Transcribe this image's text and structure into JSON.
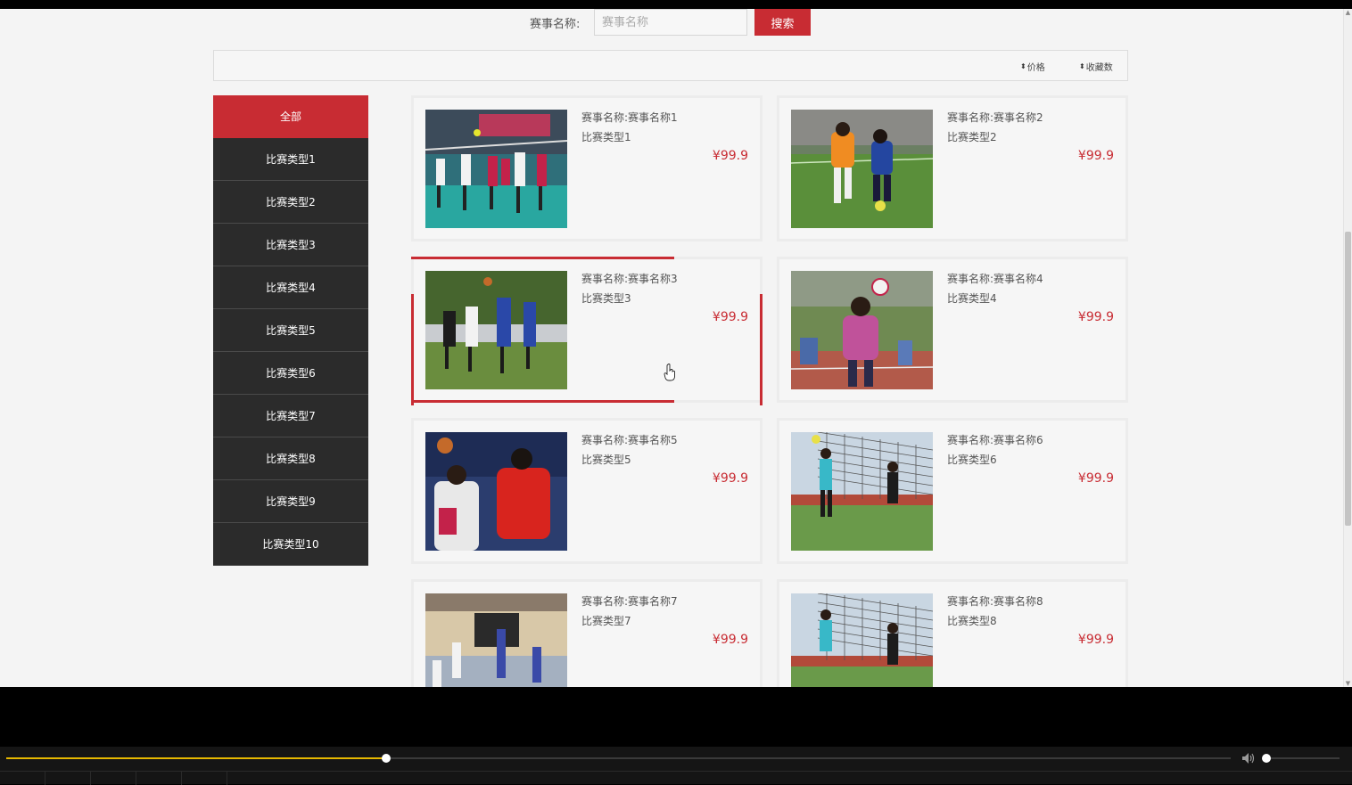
{
  "search": {
    "label": "赛事名称:",
    "placeholder": "赛事名称",
    "value": "",
    "button_label": "搜索"
  },
  "sort": {
    "price_label": "价格",
    "favorites_label": "收藏数",
    "icon": "sort-icon"
  },
  "categories": [
    {
      "label": "全部",
      "active": true
    },
    {
      "label": "比赛类型1"
    },
    {
      "label": "比赛类型2"
    },
    {
      "label": "比赛类型3"
    },
    {
      "label": "比赛类型4"
    },
    {
      "label": "比赛类型5"
    },
    {
      "label": "比赛类型6"
    },
    {
      "label": "比赛类型7"
    },
    {
      "label": "比赛类型8"
    },
    {
      "label": "比赛类型9"
    },
    {
      "label": "比赛类型10"
    }
  ],
  "events": [
    {
      "name_label": "赛事名称:",
      "name": "赛事名称1",
      "type": "比赛类型1",
      "price": "¥99.9",
      "image": "volleyball-indoor-photo"
    },
    {
      "name_label": "赛事名称:",
      "name": "赛事名称2",
      "type": "比赛类型2",
      "price": "¥99.9",
      "image": "kids-soccer-photo"
    },
    {
      "name_label": "赛事名称:",
      "name": "赛事名称3",
      "type": "比赛类型3",
      "price": "¥99.9",
      "image": "outdoor-basketball-photo"
    },
    {
      "name_label": "赛事名称:",
      "name": "赛事名称4",
      "type": "比赛类型4",
      "price": "¥99.9",
      "image": "volleyball-juggling-photo"
    },
    {
      "name_label": "赛事名称:",
      "name": "赛事名称5",
      "type": "比赛类型5",
      "price": "¥99.9",
      "image": "china-basketball-photo"
    },
    {
      "name_label": "赛事名称:",
      "name": "赛事名称6",
      "type": "比赛类型6",
      "price": "¥99.9",
      "image": "outdoor-volleyball-photo"
    },
    {
      "name_label": "赛事名称:",
      "name": "赛事名称7",
      "type": "比赛类型7",
      "price": "¥99.9",
      "image": "gym-basketball-photo"
    },
    {
      "name_label": "赛事名称:",
      "name": "赛事名称8",
      "type": "比赛类型8",
      "price": "¥99.9",
      "image": "outdoor-volleyball-photo"
    }
  ],
  "hovered_event_index": 2,
  "player": {
    "progress_fraction": 0.31,
    "volume_fraction": 0.05,
    "volume_icon": "volume-icon"
  },
  "colors": {
    "accent": "#c82c33",
    "sidebar": "#2b2b2b",
    "progress": "#e6b800"
  }
}
